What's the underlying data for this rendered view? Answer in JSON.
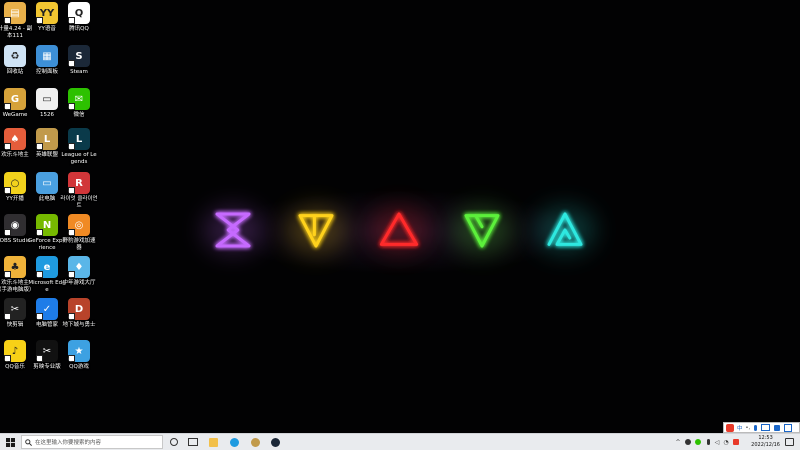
{
  "desktop_icons": [
    {
      "label": "计量4.24 - 副本111",
      "icon": "folder-icon",
      "color": "#e8b04a"
    },
    {
      "label": "YY语音",
      "icon": "yy-voice-icon",
      "color": "#f2c531"
    },
    {
      "label": "腾讯QQ",
      "icon": "qq-penguin-icon",
      "color": "#ffffff"
    },
    {
      "label": "回收站",
      "icon": "recycle-bin-icon",
      "color": "#cfe3f5"
    },
    {
      "label": "控制面板",
      "icon": "control-panel-icon",
      "color": "#3d8fd6"
    },
    {
      "label": "Steam",
      "icon": "steam-icon",
      "color": "#1b2838"
    },
    {
      "label": "WeGame",
      "icon": "wegame-icon",
      "color": "#d6a23a"
    },
    {
      "label": "1526",
      "icon": "document-icon",
      "color": "#f0f0f0"
    },
    {
      "label": "微信",
      "icon": "wechat-icon",
      "color": "#2dc100"
    },
    {
      "label": "欢乐斗地主",
      "icon": "doudizhu-icon",
      "color": "#e55d3b"
    },
    {
      "label": "英雄联盟",
      "icon": "lol-icon",
      "color": "#c19a4b"
    },
    {
      "label": "League of Legends",
      "icon": "league-of-legends-icon",
      "color": "#0a3a4a"
    },
    {
      "label": "YY开播",
      "icon": "yy-live-icon",
      "color": "#f2d21c"
    },
    {
      "label": "此电脑",
      "icon": "this-pc-icon",
      "color": "#4aa0e0"
    },
    {
      "label": "라이엇 클라이언트",
      "icon": "riot-client-icon",
      "color": "#d13639"
    },
    {
      "label": "OBS Studio",
      "icon": "obs-icon",
      "color": "#302e31"
    },
    {
      "label": "GeForce Experience",
      "icon": "geforce-icon",
      "color": "#76b900"
    },
    {
      "label": "野豹游戏加速器",
      "icon": "booster-icon",
      "color": "#f08a24"
    },
    {
      "label": "欢乐斗地主（手游电脑版）",
      "icon": "doudizhu-mobile-icon",
      "color": "#f0b33a"
    },
    {
      "label": "Microsoft Edge",
      "icon": "edge-icon",
      "color": "#1f9be0"
    },
    {
      "label": "中年游戏大厅",
      "icon": "game-hall-icon",
      "color": "#5ab6e8"
    },
    {
      "label": "快剪辑",
      "icon": "quick-cut-icon",
      "color": "#222222"
    },
    {
      "label": "电脑管家",
      "icon": "pc-manager-icon",
      "color": "#1e7ce8"
    },
    {
      "label": "地下城与勇士",
      "icon": "dnf-icon",
      "color": "#b8432a"
    },
    {
      "label": "QQ音乐",
      "icon": "qq-music-icon",
      "color": "#f7d117"
    },
    {
      "label": "剪映专业版",
      "icon": "capcut-icon",
      "color": "#111111"
    },
    {
      "label": "QQ游戏",
      "icon": "qq-game-icon",
      "color": "#3da1e2"
    }
  ],
  "wallpaper_symbols": [
    {
      "icon": "hourglass-glyph-icon",
      "color": "#c66bff"
    },
    {
      "icon": "inverted-triangle-glyph-icon",
      "color": "#ffd21e"
    },
    {
      "icon": "triangle-glyph-icon",
      "color": "#ff2c2c"
    },
    {
      "icon": "down-triangle-glyph-icon",
      "color": "#5cf03a"
    },
    {
      "icon": "spiral-triangle-glyph-icon",
      "color": "#2ee8e0"
    }
  ],
  "taskbar": {
    "search_placeholder": "在这里输入你要搜索的内容",
    "pinned_apps": [
      "cortana-icon",
      "task-view-icon",
      "file-explorer-icon",
      "edge-icon",
      "lol-icon",
      "steam-icon"
    ],
    "clock_time": "12:53",
    "clock_date": "2022/12/16"
  },
  "ime_toolbar": {
    "mode_label": "中"
  },
  "colors": {
    "taskbar_bg": "#e9ebee",
    "desktop_bg": "#020203"
  }
}
